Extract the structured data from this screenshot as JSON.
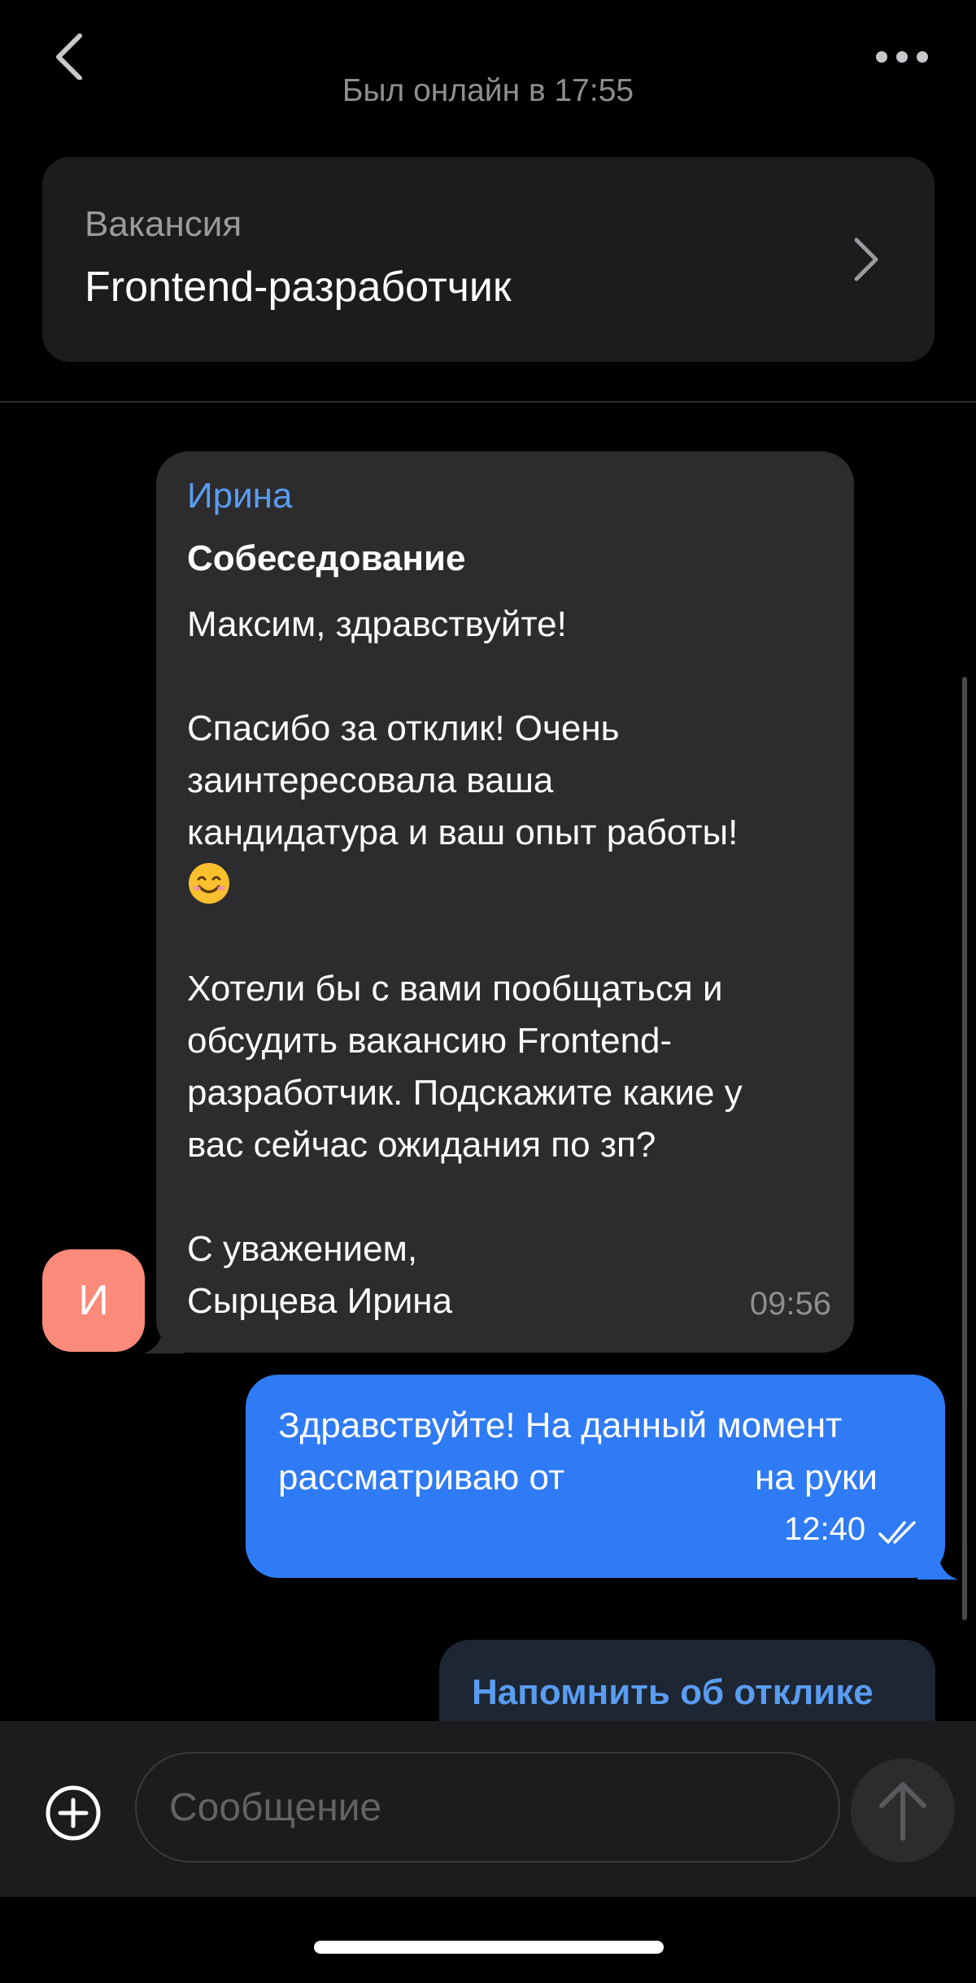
{
  "header": {
    "status": "Был онлайн в 17:55",
    "back_icon": "chevron-left-icon",
    "more_icon": "more-horizontal-icon"
  },
  "vacancy": {
    "label": "Вакансия",
    "title": "Frontend-разработчик",
    "chevron_icon": "chevron-right-icon"
  },
  "avatar": {
    "initial": "И",
    "color": "#fa8a7a"
  },
  "incoming": {
    "sender": "Ирина",
    "subject": "Собеседование",
    "lines": [
      "Максим, здравствуйте!",
      "",
      "Спасибо за отклик! Очень",
      "заинтересовала ваша",
      "кандидатура и ваш опыт работы!",
      "",
      "",
      "Хотели бы с вами пообщаться и",
      "обсудить вакансию Frontend-",
      "разработчик. Подскажите какие у",
      "вас сейчас ожидания по зп?",
      "",
      "С уважением,",
      "Сырцева Ирина"
    ],
    "emoji": "smiling-face-emoji",
    "time": "09:56"
  },
  "outgoing": {
    "line1": "Здравствуйте! На данный момент",
    "line2_start": "рассматриваю от",
    "line2_end": "на руки",
    "time": "12:40",
    "status_icon": "double-check-icon"
  },
  "remind_button": {
    "label": "Напомнить об отклике"
  },
  "composer": {
    "placeholder": "Сообщение",
    "add_icon": "plus-circle-icon",
    "send_icon": "arrow-up-icon"
  },
  "colors": {
    "accent": "#2f7bf5",
    "link": "#5a9cf0",
    "bubble_incoming": "#2c2c2e",
    "background": "#000000"
  }
}
